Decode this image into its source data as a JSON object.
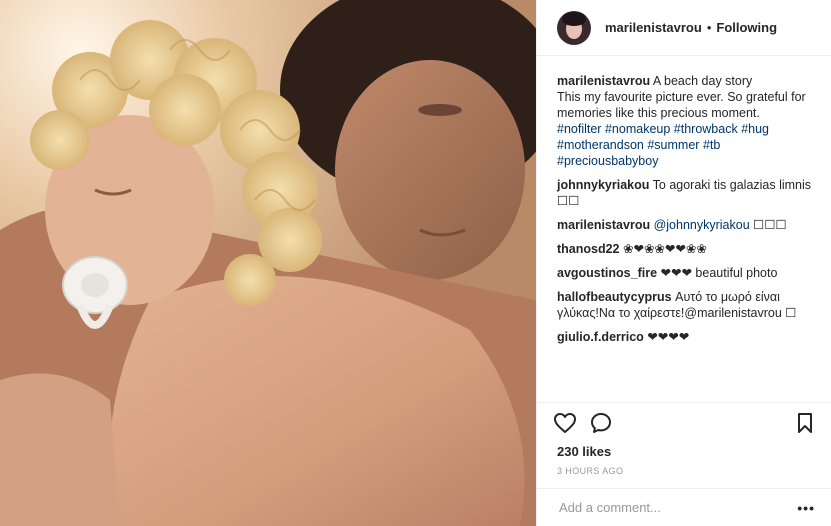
{
  "post": {
    "username": "marilenistavrou",
    "separator": "•",
    "follow_status": "Following",
    "caption": {
      "username": "marilenistavrou",
      "title": "A beach day story",
      "text": "This my favourite picture ever. So grateful for memories like this precious moment.",
      "hashtags": [
        "#nofilter",
        "#nomakeup",
        "#throwback",
        "#hug",
        "#motherandson",
        "#summer",
        "#tb",
        "#preciousbabyboy"
      ]
    },
    "comments": [
      {
        "username": "johnnykyriakou",
        "text": "To agoraki tis galazias limnis ☐☐"
      },
      {
        "username": "marilenistavrou",
        "mention": "@johnnykyriakou",
        "text": "☐☐☐"
      },
      {
        "username": "thanosd22",
        "text": "❀❤❀❀❤❤❀❀"
      },
      {
        "username": "avgoustinos_fire",
        "text": "❤❤❤ beautiful photo"
      },
      {
        "username": "hallofbeautycyprus",
        "text": "Αυτό το μωρό είναι γλύκας!Να το χαίρεστε!@marilenistavrou ☐"
      },
      {
        "username": "giulio.f.derrico",
        "text": "❤❤❤❤"
      }
    ],
    "likes": "230 likes",
    "timestamp": "3 HOURS AGO",
    "add_comment_placeholder": "Add a comment...",
    "more_options": "•••",
    "icons": {
      "like": "heart-icon",
      "comment": "comment-bubble-icon",
      "save": "bookmark-icon",
      "more": "more-options-icon"
    },
    "colors": {
      "text": "#262626",
      "link": "#003569",
      "muted": "#999999",
      "border": "#efefef"
    }
  }
}
